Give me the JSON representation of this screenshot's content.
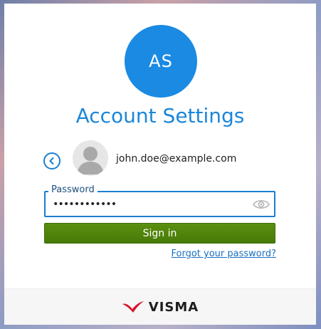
{
  "account": {
    "initials": "AS",
    "title": "Account Settings"
  },
  "user": {
    "email": "john.doe@example.com"
  },
  "password": {
    "label": "Password",
    "value": "••••••••••••"
  },
  "actions": {
    "sign_in_label": "Sign in",
    "forgot_label": "Forgot your password?"
  },
  "footer": {
    "brand": "VISMA"
  },
  "colors": {
    "accent": "#1a8ae3",
    "button": "#4f8410",
    "brand_red": "#d8142c"
  },
  "icons": {
    "back": "chevron-left-icon",
    "show_password": "eye-icon",
    "user": "user-silhouette-icon",
    "logo": "visma-logo"
  }
}
